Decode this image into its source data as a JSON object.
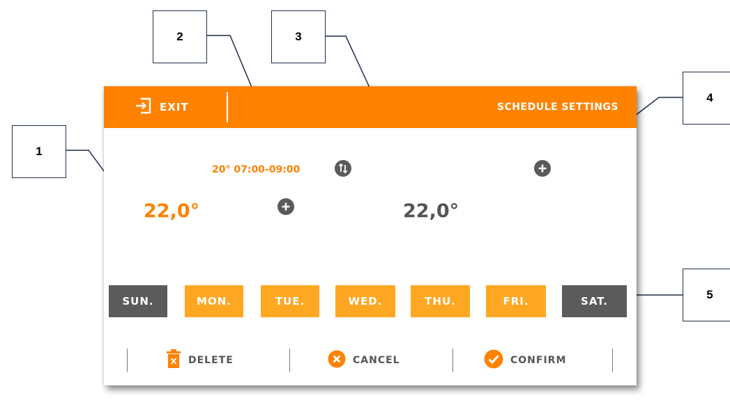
{
  "callouts": [
    "1",
    "2",
    "3",
    "4",
    "5"
  ],
  "header": {
    "exit_label": "EXIT",
    "title": "SCHEDULE SETTINGS"
  },
  "schedule": {
    "interval_label": "20° 07:00-09:00",
    "active_temp": "22,0°",
    "base_temp": "22,0°"
  },
  "days": [
    {
      "label": "SUN.",
      "active": false
    },
    {
      "label": "MON.",
      "active": true
    },
    {
      "label": "TUE.",
      "active": true
    },
    {
      "label": "WED.",
      "active": true
    },
    {
      "label": "THU.",
      "active": true
    },
    {
      "label": "FRI.",
      "active": true
    },
    {
      "label": "SAT.",
      "active": false
    }
  ],
  "actions": {
    "delete_label": "DELETE",
    "cancel_label": "CANCEL",
    "confirm_label": "CONFIRM"
  },
  "icons": {
    "exit": "exit-icon",
    "swap": "swap-icon",
    "add": "plus-icon",
    "delete": "trash-icon",
    "cancel": "close-circle-icon",
    "confirm": "check-circle-icon"
  },
  "colors": {
    "accent": "#ff8200",
    "day_active": "#ffa722",
    "day_inactive": "#5b5b5b",
    "text_dark": "#555555",
    "icon_gray": "#5a5a5a"
  }
}
